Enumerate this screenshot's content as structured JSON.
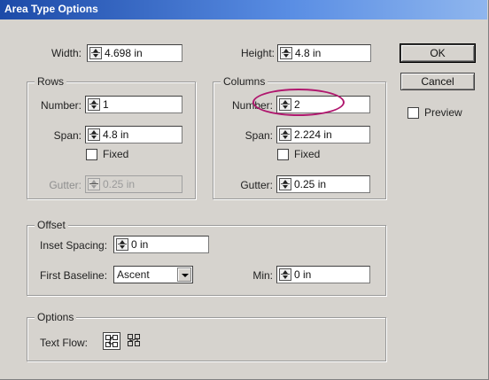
{
  "window": {
    "title": "Area Type Options"
  },
  "size": {
    "width": {
      "label": "Width:",
      "value": "4.698 in"
    },
    "height": {
      "label": "Height:",
      "value": "4.8 in"
    }
  },
  "rows": {
    "legend": "Rows",
    "number": {
      "label": "Number:",
      "value": "1"
    },
    "span": {
      "label": "Span:",
      "value": "4.8 in"
    },
    "fixed": {
      "label": "Fixed",
      "checked": false
    },
    "gutter": {
      "label": "Gutter:",
      "value": "0.25 in",
      "disabled": true
    }
  },
  "columns": {
    "legend": "Columns",
    "number": {
      "label": "Number:",
      "value": "2"
    },
    "span": {
      "label": "Span:",
      "value": "2.224 in"
    },
    "fixed": {
      "label": "Fixed",
      "checked": false
    },
    "gutter": {
      "label": "Gutter:",
      "value": "0.25 in"
    }
  },
  "offset": {
    "legend": "Offset",
    "inset_spacing": {
      "label": "Inset Spacing:",
      "value": "0 in"
    },
    "first_baseline": {
      "label": "First Baseline:",
      "value": "Ascent"
    },
    "min": {
      "label": "Min:",
      "value": "0 in"
    }
  },
  "options": {
    "legend": "Options",
    "text_flow_label": "Text Flow:",
    "text_flow_icons": [
      "text-flow-rows-icon",
      "text-flow-columns-icon"
    ]
  },
  "buttons": {
    "ok": "OK",
    "cancel": "Cancel"
  },
  "preview": {
    "label": "Preview",
    "checked": false
  },
  "colors": {
    "titlebar": "#1c4aa8",
    "dialog_bg": "#d6d3ce",
    "callout": "#b0176e"
  }
}
